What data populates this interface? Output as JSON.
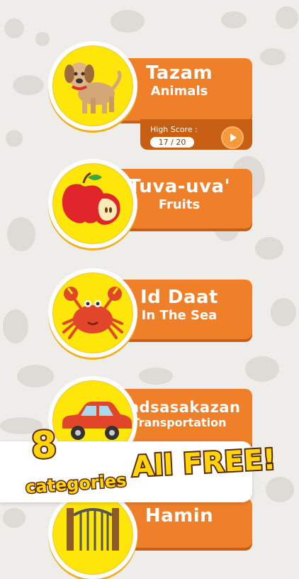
{
  "categories": [
    {
      "title": "Tazam",
      "subtitle": "Animals",
      "icon": "dog-icon",
      "high_score_label": "High Score :",
      "high_score": "17 / 20"
    },
    {
      "title": "Tuva-uva'",
      "subtitle": "Fruits",
      "icon": "apple-icon"
    },
    {
      "title": "Id Daat",
      "subtitle": "In The Sea",
      "icon": "crab-icon"
    },
    {
      "title": "Padsasakazan",
      "subtitle": "Transportation",
      "icon": "car-icon"
    },
    {
      "title": "Hamin",
      "subtitle": "",
      "icon": "gate-icon"
    }
  ],
  "promo": {
    "number": "8",
    "categories": "categories",
    "free": "All FREE!"
  },
  "colors": {
    "banner": "#f07f2a",
    "circle": "#ffe60a",
    "background": "#efedea",
    "promo_text": "#ffd40a"
  }
}
